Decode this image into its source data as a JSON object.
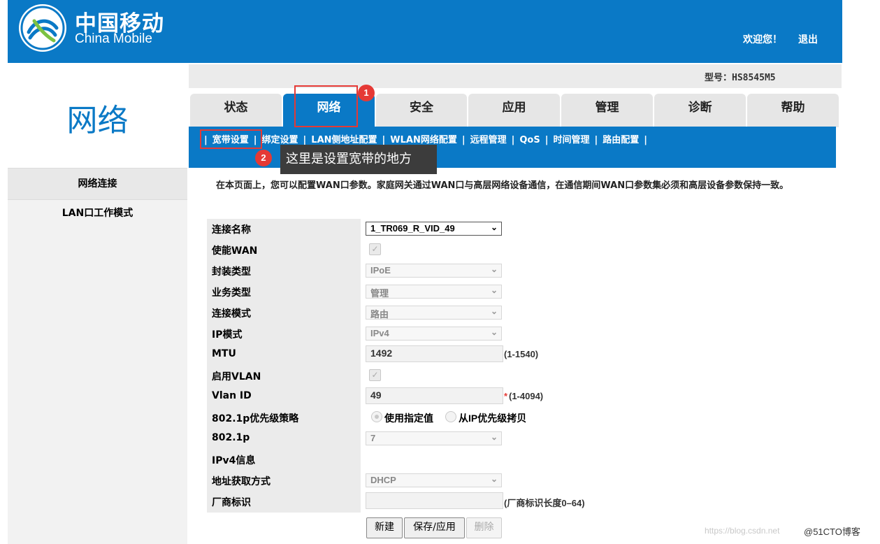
{
  "header": {
    "brand_cn": "中国移动",
    "brand_en": "China Mobile",
    "welcome": "欢迎您！",
    "logout": "退出",
    "bg_color": "#0a79c6"
  },
  "model": {
    "label": "型号：HS8545M5"
  },
  "left": {
    "title": "网络",
    "items": [
      {
        "label": "网络连接"
      },
      {
        "label": "LAN口工作模式"
      }
    ]
  },
  "tabs": [
    {
      "label": "状态",
      "active": false
    },
    {
      "label": "网络",
      "active": true
    },
    {
      "label": "安全",
      "active": false
    },
    {
      "label": "应用",
      "active": false
    },
    {
      "label": "管理",
      "active": false
    },
    {
      "label": "诊断",
      "active": false
    },
    {
      "label": "帮助",
      "active": false
    }
  ],
  "subnav": [
    {
      "label": "宽带设置",
      "active": true
    },
    {
      "label": "绑定设置"
    },
    {
      "label": "LAN侧地址配置"
    },
    {
      "label": "WLAN网络配置"
    },
    {
      "label": "远程管理"
    },
    {
      "label": "QoS"
    },
    {
      "label": "时间管理"
    },
    {
      "label": "路由配置"
    }
  ],
  "annotations": {
    "badge1": "1",
    "badge2": "2",
    "tooltip": "这里是设置宽带的地方",
    "color": "#e53935"
  },
  "description": "在本页面上，您可以配置WAN口参数。家庭网关通过WAN口与高层网络设备通信，在通信期间WAN口参数集必须和高层设备参数保持一致。",
  "form": {
    "connection_name": {
      "label": "连接名称",
      "value": "1_TR069_R_VID_49"
    },
    "enable_wan": {
      "label": "使能WAN",
      "checked": true
    },
    "encapsulation": {
      "label": "封装类型",
      "value": "IPoE"
    },
    "service_type": {
      "label": "业务类型",
      "value": "管理"
    },
    "connection_mode": {
      "label": "连接模式",
      "value": "路由"
    },
    "ip_mode": {
      "label": "IP模式",
      "value": "IPv4"
    },
    "mtu": {
      "label": "MTU",
      "value": "1492",
      "hint": "(1-1540)"
    },
    "enable_vlan": {
      "label": "启用VLAN",
      "checked": true
    },
    "vlan_id": {
      "label": "Vlan ID",
      "value": "49",
      "required_mark": "*",
      "hint": "(1-4094)"
    },
    "priority_policy": {
      "label": "802.1p优先级策略",
      "option1": "使用指定值",
      "option2": "从IP优先级拷贝"
    },
    "priority": {
      "label": "802.1p",
      "value": "7"
    },
    "ipv4_info": {
      "label": "IPv4信息"
    },
    "address_method": {
      "label": "地址获取方式",
      "value": "DHCP"
    },
    "vendor_id": {
      "label": "厂商标识",
      "value": "",
      "hint": "(厂商标识长度0–64)"
    }
  },
  "buttons": {
    "new": "新建",
    "save": "保存/应用",
    "delete": "删除"
  },
  "watermark": {
    "url": "https://blog.csdn.net",
    "credit": "@51CTO博客"
  }
}
